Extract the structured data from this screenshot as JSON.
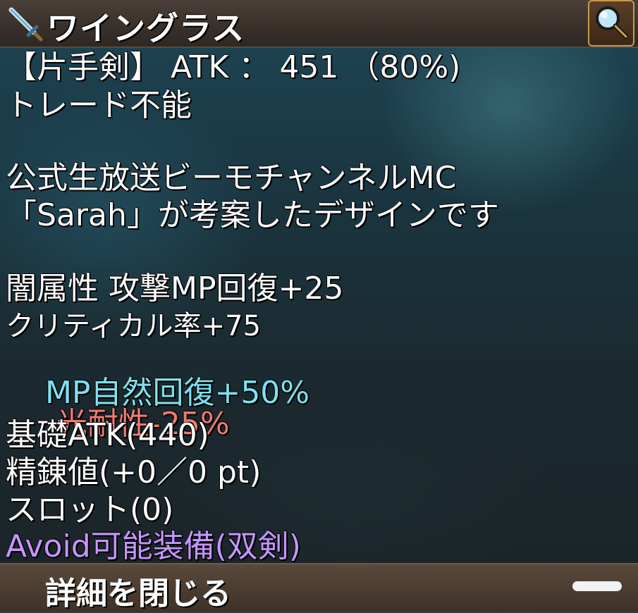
{
  "header": {
    "title": "ワイングラス",
    "item_icon": "sword-icon",
    "zoom_icon": "magnifier-icon"
  },
  "details": {
    "type_line": "【片手剣】 ATK ： 451 （80%)",
    "trade": "トレード不能",
    "desc1": "公式生放送ビーモチャンネルMC",
    "desc2": "「Sarah」が考案したデザインです",
    "stat1": "闇属性 攻撃MP回復+25",
    "stat2": "クリティカル率+75",
    "stat3a": "MP自然回復+50%",
    "stat3b": "光耐性-25%",
    "base_atk": "基礎ATK(440)",
    "refine": "精錬値(+0／0 pt)",
    "slot": "スロット(0)",
    "avoid": "Avoid可能装備(双剣)"
  },
  "footer": {
    "close_label": "詳細を閉じる"
  },
  "colors": {
    "cyan_text": "#7fe0ee",
    "red_text": "#f07a72",
    "purple_text": "#c596ff"
  }
}
